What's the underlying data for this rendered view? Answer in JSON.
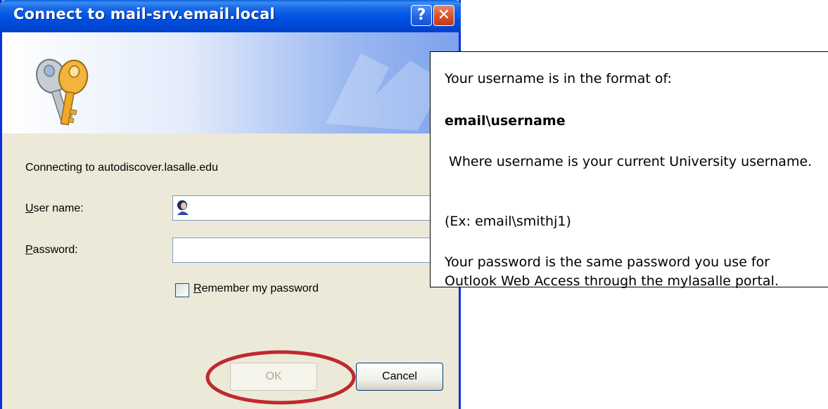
{
  "dialog": {
    "title": "Connect to mail-srv.email.local",
    "help_button": "?",
    "close_button": "✕",
    "connecting_text": "Connecting to autodiscover.lasalle.edu",
    "username": {
      "label_accel": "U",
      "label_rest": "ser name:",
      "value": ""
    },
    "password": {
      "label_accel": "P",
      "label_rest": "assword:",
      "value": ""
    },
    "remember": {
      "label_accel": "R",
      "label_rest": "emember my password",
      "checked": false
    },
    "ok_label": "OK",
    "cancel_label": "Cancel"
  },
  "callout": {
    "line1": "Your username is in the format of:",
    "line2": "email\\username",
    "line3": " Where username is your current University username.",
    "line4": "(Ex: email\\smithj1)",
    "line5": "Your password is the same password you use for Outlook Web Access through the mylasalle portal."
  },
  "colors": {
    "titlebar": "#0055E5",
    "dialog_bg": "#ECE9D8",
    "highlight_ring": "#C0282E"
  },
  "icons": [
    "keys-icon",
    "user-icon",
    "help-icon",
    "close-icon",
    "dropdown-arrow-icon"
  ]
}
